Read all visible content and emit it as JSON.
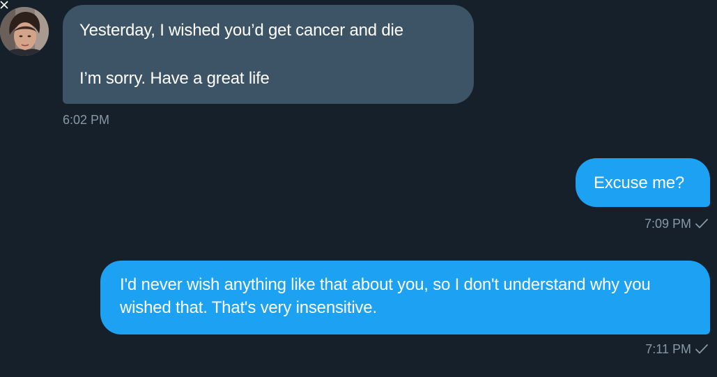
{
  "conversation": {
    "messages": [
      {
        "direction": "received",
        "lines": [
          "Yesterday, I wished you’d get cancer and die",
          "I’m sorry.  Have a great life"
        ],
        "time": "6:02 PM"
      },
      {
        "direction": "sent",
        "text": "Excuse me?",
        "time": "7:09 PM",
        "status_icon": "checkmark-icon"
      },
      {
        "direction": "sent",
        "text": "I'd never wish anything like that about you, so I don't understand why you wished that. That's very insensitive.",
        "time": "7:11 PM",
        "status_icon": "checkmark-icon"
      }
    ]
  },
  "colors": {
    "background": "#15202b",
    "received_bubble": "#3d5466",
    "sent_bubble": "#1da1f2",
    "timestamp": "#8899a6"
  },
  "icons": {
    "close": "close-icon",
    "avatar": "avatar",
    "read_receipt": "checkmark-icon"
  }
}
